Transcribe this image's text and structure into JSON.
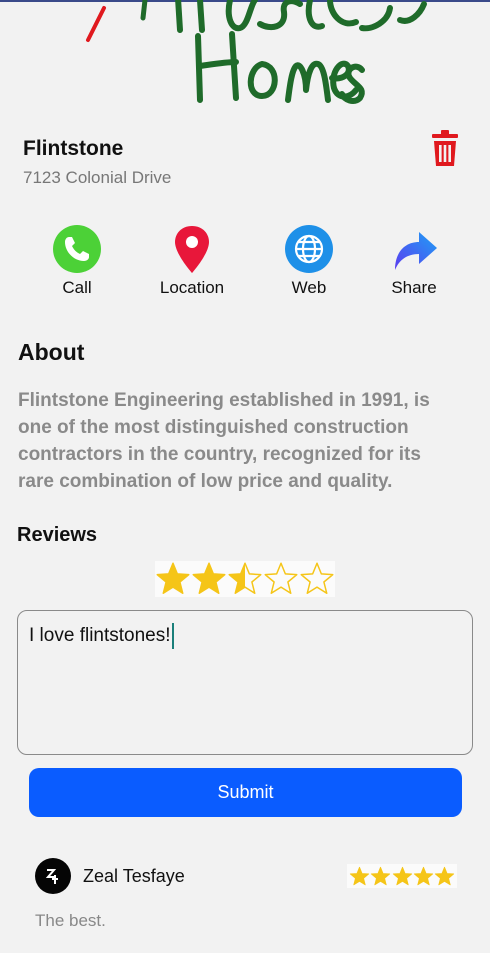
{
  "business": {
    "name": "Flintstone",
    "address": "7123 Colonial Drive"
  },
  "actions": [
    {
      "label": "Call",
      "icon": "phone-icon"
    },
    {
      "label": "Location",
      "icon": "map-pin-icon"
    },
    {
      "label": "Web",
      "icon": "globe-icon"
    },
    {
      "label": "Share",
      "icon": "share-arrow-icon"
    }
  ],
  "about": {
    "heading": "About",
    "text": "Flintstone Engineering established in 1991, is one of the most distinguished construction contractors in the country, recognized for its rare combination of low price and quality."
  },
  "reviews": {
    "heading": "Reviews",
    "rating_input_value": 2.5,
    "rating_max": 5,
    "input_value": "I love flintstones!",
    "submit_label": "Submit",
    "items": [
      {
        "author": "Zeal Tesfaye",
        "rating": 5,
        "text": "The best."
      }
    ]
  },
  "colors": {
    "accent": "#0a5cff",
    "star": "#f5c518",
    "delete": "#e0191e",
    "call": "#4cd137",
    "location": "#e8173a",
    "web": "#1e90e8",
    "share": "#2f7ff0"
  }
}
